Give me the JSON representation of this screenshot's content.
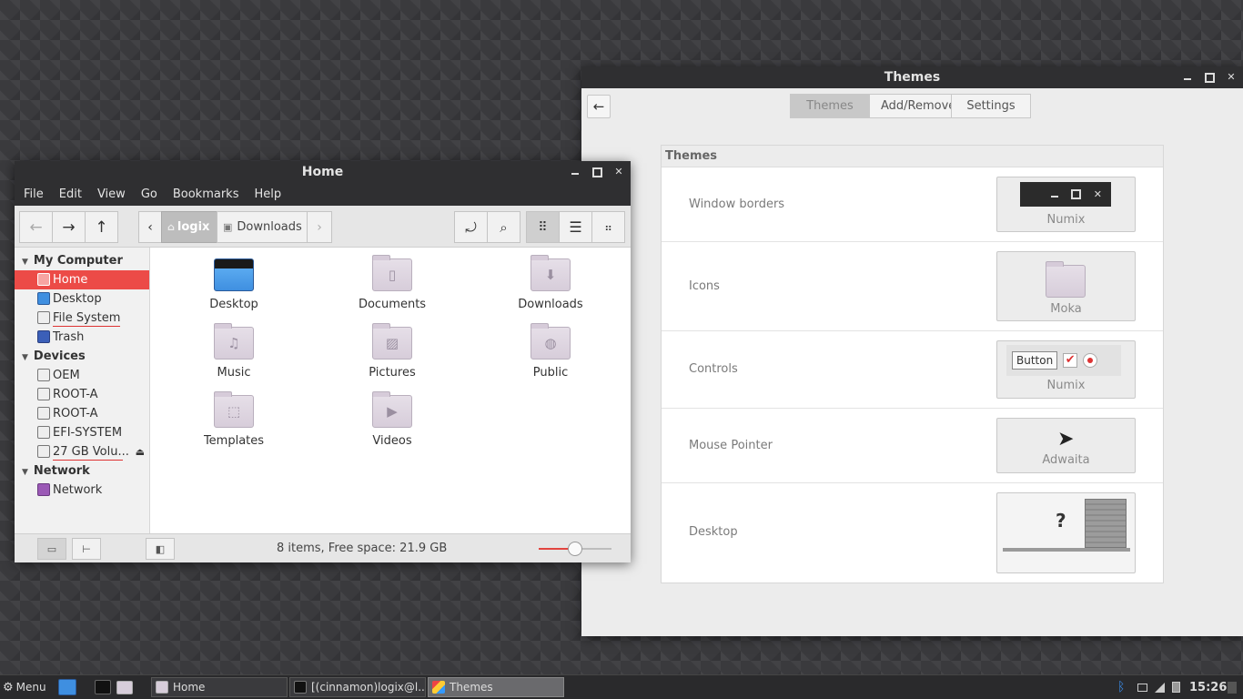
{
  "themes_window": {
    "title": "Themes",
    "tabs": [
      "Themes",
      "Add/Remove",
      "Settings"
    ],
    "panel_title": "Themes",
    "rows": [
      {
        "label": "Window borders",
        "value": "Numix"
      },
      {
        "label": "Icons",
        "value": "Moka"
      },
      {
        "label": "Controls",
        "value": "Numix",
        "button_label": "Button"
      },
      {
        "label": "Mouse Pointer",
        "value": "Adwaita"
      },
      {
        "label": "Desktop",
        "value": "?"
      }
    ]
  },
  "files_window": {
    "title": "Home",
    "menu": [
      "File",
      "Edit",
      "View",
      "Go",
      "Bookmarks",
      "Help"
    ],
    "breadcrumb": [
      "logix",
      "Downloads"
    ],
    "sidebar": {
      "sections": [
        {
          "title": "My Computer",
          "items": [
            "Home",
            "Desktop",
            "File System",
            "Trash"
          ]
        },
        {
          "title": "Devices",
          "items": [
            "OEM",
            "ROOT-A",
            "ROOT-A",
            "EFI-SYSTEM",
            "27 GB Volu..."
          ]
        },
        {
          "title": "Network",
          "items": [
            "Network"
          ]
        }
      ],
      "selected": "Home"
    },
    "items": [
      "Desktop",
      "Documents",
      "Downloads",
      "Music",
      "Pictures",
      "Public",
      "Templates",
      "Videos"
    ],
    "status": "8 items, Free space: 21.9 GB",
    "zoom_level": 0.5
  },
  "taskbar": {
    "menu_label": "Menu",
    "windows": [
      "Home",
      "[(cinnamon)logix@l...",
      "Themes"
    ],
    "active_window": "Themes",
    "clock": "15:26"
  }
}
